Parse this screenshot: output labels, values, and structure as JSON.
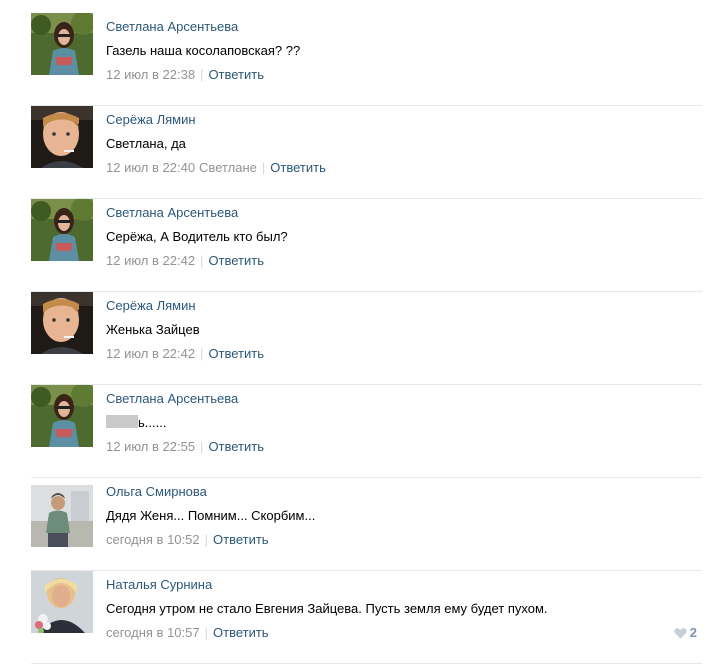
{
  "reply_label": "Ответить",
  "comments": [
    {
      "author": "Светлана Арсентьева",
      "text": "Газель наша косолаповская? ??",
      "time": "12 июл в 22:38",
      "avatar": "svetlana"
    },
    {
      "author": "Серёжа Лямин",
      "text": "Светлана, да",
      "time": "12 июл в 22:40",
      "addressee": "Светлане",
      "avatar": "serezha"
    },
    {
      "author": "Светлана Арсентьева",
      "text": "Серёжа, А Водитель кто был?",
      "time": "12 июл в 22:42",
      "avatar": "svetlana"
    },
    {
      "author": "Серёжа Лямин",
      "text": "Женька Зайцев",
      "time": "12 июл в 22:42",
      "avatar": "serezha"
    },
    {
      "author": "Светлана Арсентьева",
      "text": "ь......",
      "redacted_prefix": true,
      "time": "12 июл в 22:55",
      "avatar": "svetlana"
    },
    {
      "author": "Ольга Смирнова",
      "text": "Дядя Женя... Помним... Скорбим...",
      "time": "сегодня в 10:52",
      "avatar": "olga"
    },
    {
      "author": "Наталья Сурнина",
      "text": "Сегодня утром не стало Евгения Зайцева. Пусть земля ему будет пухом.",
      "time": "сегодня в 10:57",
      "avatar": "natalya",
      "likes": "2"
    }
  ],
  "colors": {
    "link": "#2b587a",
    "meta": "#939393",
    "separator": "#e7e8ec",
    "like": "#7993ae"
  }
}
